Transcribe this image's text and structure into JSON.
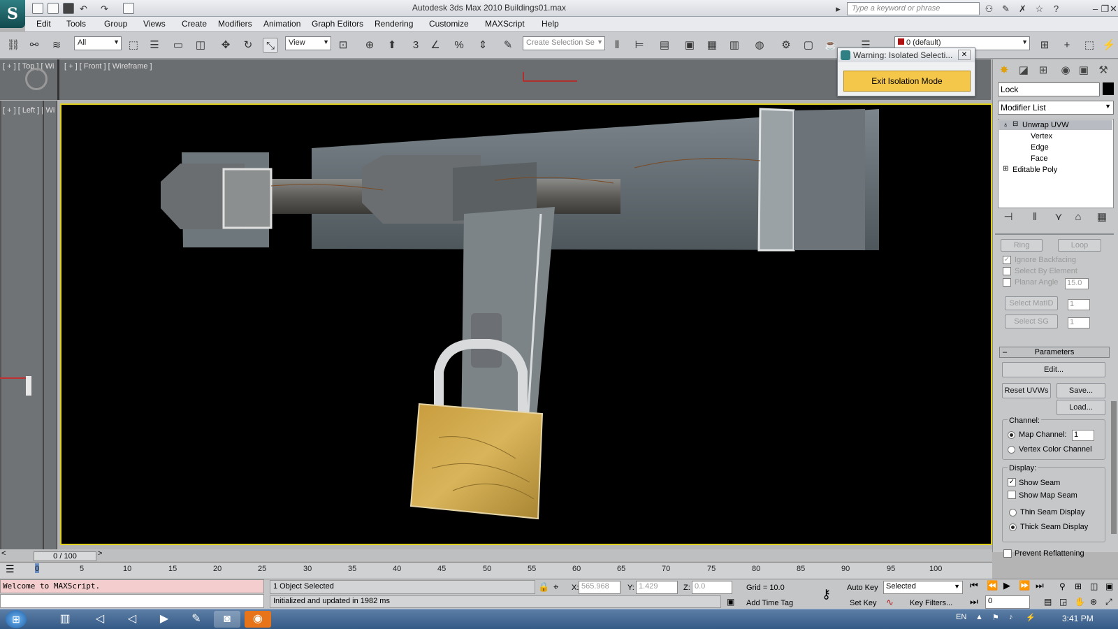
{
  "app": {
    "logo": "S",
    "title": "Autodesk 3ds Max  2010      Buildings01.max",
    "search_placeholder": "Type a keyword or phrase"
  },
  "menu": [
    "Edit",
    "Tools",
    "Group",
    "Views",
    "Create",
    "Modifiers",
    "Animation",
    "Graph Editors",
    "Rendering",
    "Customize",
    "MAXScript",
    "Help"
  ],
  "toolbar": {
    "filter": "All",
    "ref_coord": "View",
    "selection_set": "Create Selection Se",
    "layer": "0 (default)",
    "snap_label": "3"
  },
  "viewports": {
    "top": "[ + ] [ Top ] [ Wi",
    "front": "[ + ] [ Front ] [ Wireframe ]",
    "left": "[ + ] [ Left ] [ Wi"
  },
  "warning": {
    "title": "Warning: Isolated Selecti...",
    "button": "Exit Isolation Mode"
  },
  "command_panel": {
    "object_name": "Lock",
    "object_color": "#000000",
    "modifier_list": "Modifier List",
    "stack": {
      "modifier": "Unwrap UVW",
      "vertex": "Vertex",
      "edge": "Edge",
      "face": "Face",
      "base": "Editable Poly"
    },
    "selection": {
      "ring": "Ring",
      "loop": "Loop",
      "ignore_backfacing": "Ignore Backfacing",
      "select_by_element": "Select By Element",
      "planar_angle": "Planar Angle",
      "planar_angle_value": "15.0",
      "select_matid": "Select MatID",
      "matid_value": "1",
      "select_sg": "Select SG",
      "sg_value": "1"
    },
    "parameters": {
      "title": "Parameters",
      "edit": "Edit...",
      "reset": "Reset UVWs",
      "save": "Save...",
      "load": "Load..."
    },
    "channel": {
      "title": "Channel:",
      "map_channel": "Map Channel:",
      "map_channel_value": "1",
      "vertex_color": "Vertex Color Channel"
    },
    "display": {
      "title": "Display:",
      "show_seam": "Show Seam",
      "show_map_seam": "Show Map Seam",
      "thin_seam": "Thin Seam Display",
      "thick_seam": "Thick Seam Display"
    },
    "prevent": "Prevent Reflattening"
  },
  "timeline": {
    "slider": "0 / 100",
    "ticks": [
      "0",
      "5",
      "10",
      "15",
      "20",
      "25",
      "30",
      "35",
      "40",
      "45",
      "50",
      "55",
      "60",
      "65",
      "70",
      "75",
      "80",
      "85",
      "90",
      "95",
      "100"
    ]
  },
  "status": {
    "maxscript": "Welcome to MAXScript.",
    "selected": "1 Object Selected",
    "prompt": "Initialized and updated in 1982 ms",
    "x_label": "X:",
    "x": "565.968",
    "y_label": "Y:",
    "y": "1.429",
    "z_label": "Z:",
    "z": "0.0",
    "grid": "Grid = 10.0",
    "add_time_tag": "Add Time Tag",
    "auto_key": "Auto Key",
    "set_key": "Set Key",
    "key_mode": "Selected",
    "key_filters": "Key Filters...",
    "frame": "0"
  },
  "taskbar": {
    "lang": "EN",
    "clock": "3:41 PM"
  }
}
